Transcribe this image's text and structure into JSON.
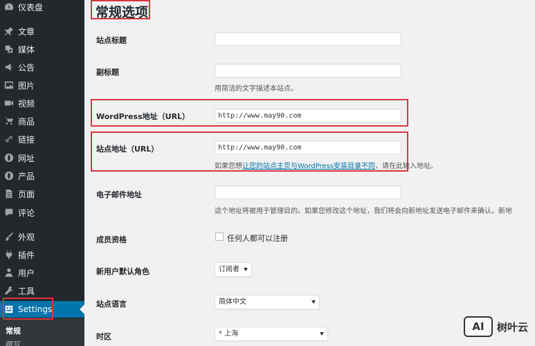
{
  "sidebar": {
    "items": [
      {
        "label": "仪表盘",
        "icon": "dashboard-icon"
      },
      {
        "label": "文章",
        "icon": "pin-icon"
      },
      {
        "label": "媒体",
        "icon": "media-icon"
      },
      {
        "label": "公告",
        "icon": "megaphone-icon"
      },
      {
        "label": "图片",
        "icon": "image-icon"
      },
      {
        "label": "视频",
        "icon": "video-icon"
      },
      {
        "label": "商品",
        "icon": "cart-icon"
      },
      {
        "label": "链接",
        "icon": "link-icon"
      },
      {
        "label": "网址",
        "icon": "globe-icon"
      },
      {
        "label": "产品",
        "icon": "globe-icon"
      },
      {
        "label": "页面",
        "icon": "page-icon"
      },
      {
        "label": "评论",
        "icon": "comment-icon"
      },
      {
        "label": "外观",
        "icon": "brush-icon"
      },
      {
        "label": "插件",
        "icon": "plugin-icon"
      },
      {
        "label": "用户",
        "icon": "user-icon"
      },
      {
        "label": "工具",
        "icon": "wrench-icon"
      },
      {
        "label": "Settings",
        "icon": "settings-icon"
      }
    ],
    "submenu": [
      {
        "label": "常规"
      },
      {
        "label": "撰写"
      }
    ]
  },
  "page": {
    "title": "常规选项"
  },
  "form": {
    "site_title_label": "站点标题",
    "site_title_value": "",
    "tagline_label": "副标题",
    "tagline_value": "",
    "tagline_desc": "用简洁的文字描述本站点。",
    "wp_url_label": "WordPress地址（URL）",
    "wp_url_value": "http://www.may90.com",
    "site_url_label": "站点地址（URL）",
    "site_url_value": "http://www.may90.com",
    "site_url_desc_before": "如果您想",
    "site_url_desc_link": "让您的站点主页与WordPress安装目录不同",
    "site_url_desc_after": "，请在此输入地址。",
    "email_label": "电子邮件地址",
    "email_value": "",
    "email_desc": "这个地址将被用于管理目的。如果您修改这个地址，我们将会向新地址发送电子邮件来确认。新地",
    "membership_label": "成员资格",
    "membership_checkbox": "任何人都可以注册",
    "default_role_label": "新用户默认角色",
    "default_role_value": "订阅者",
    "language_label": "站点语言",
    "language_value": "简体中文",
    "timezone_label": "时区",
    "timezone_value": "* 上海"
  },
  "watermark": {
    "badge": "AI",
    "text": "树叶云"
  },
  "colors": {
    "sidebar_bg": "#23282d",
    "active_bg": "#0073aa",
    "highlight_red": "#d9363e",
    "link": "#0073aa"
  }
}
